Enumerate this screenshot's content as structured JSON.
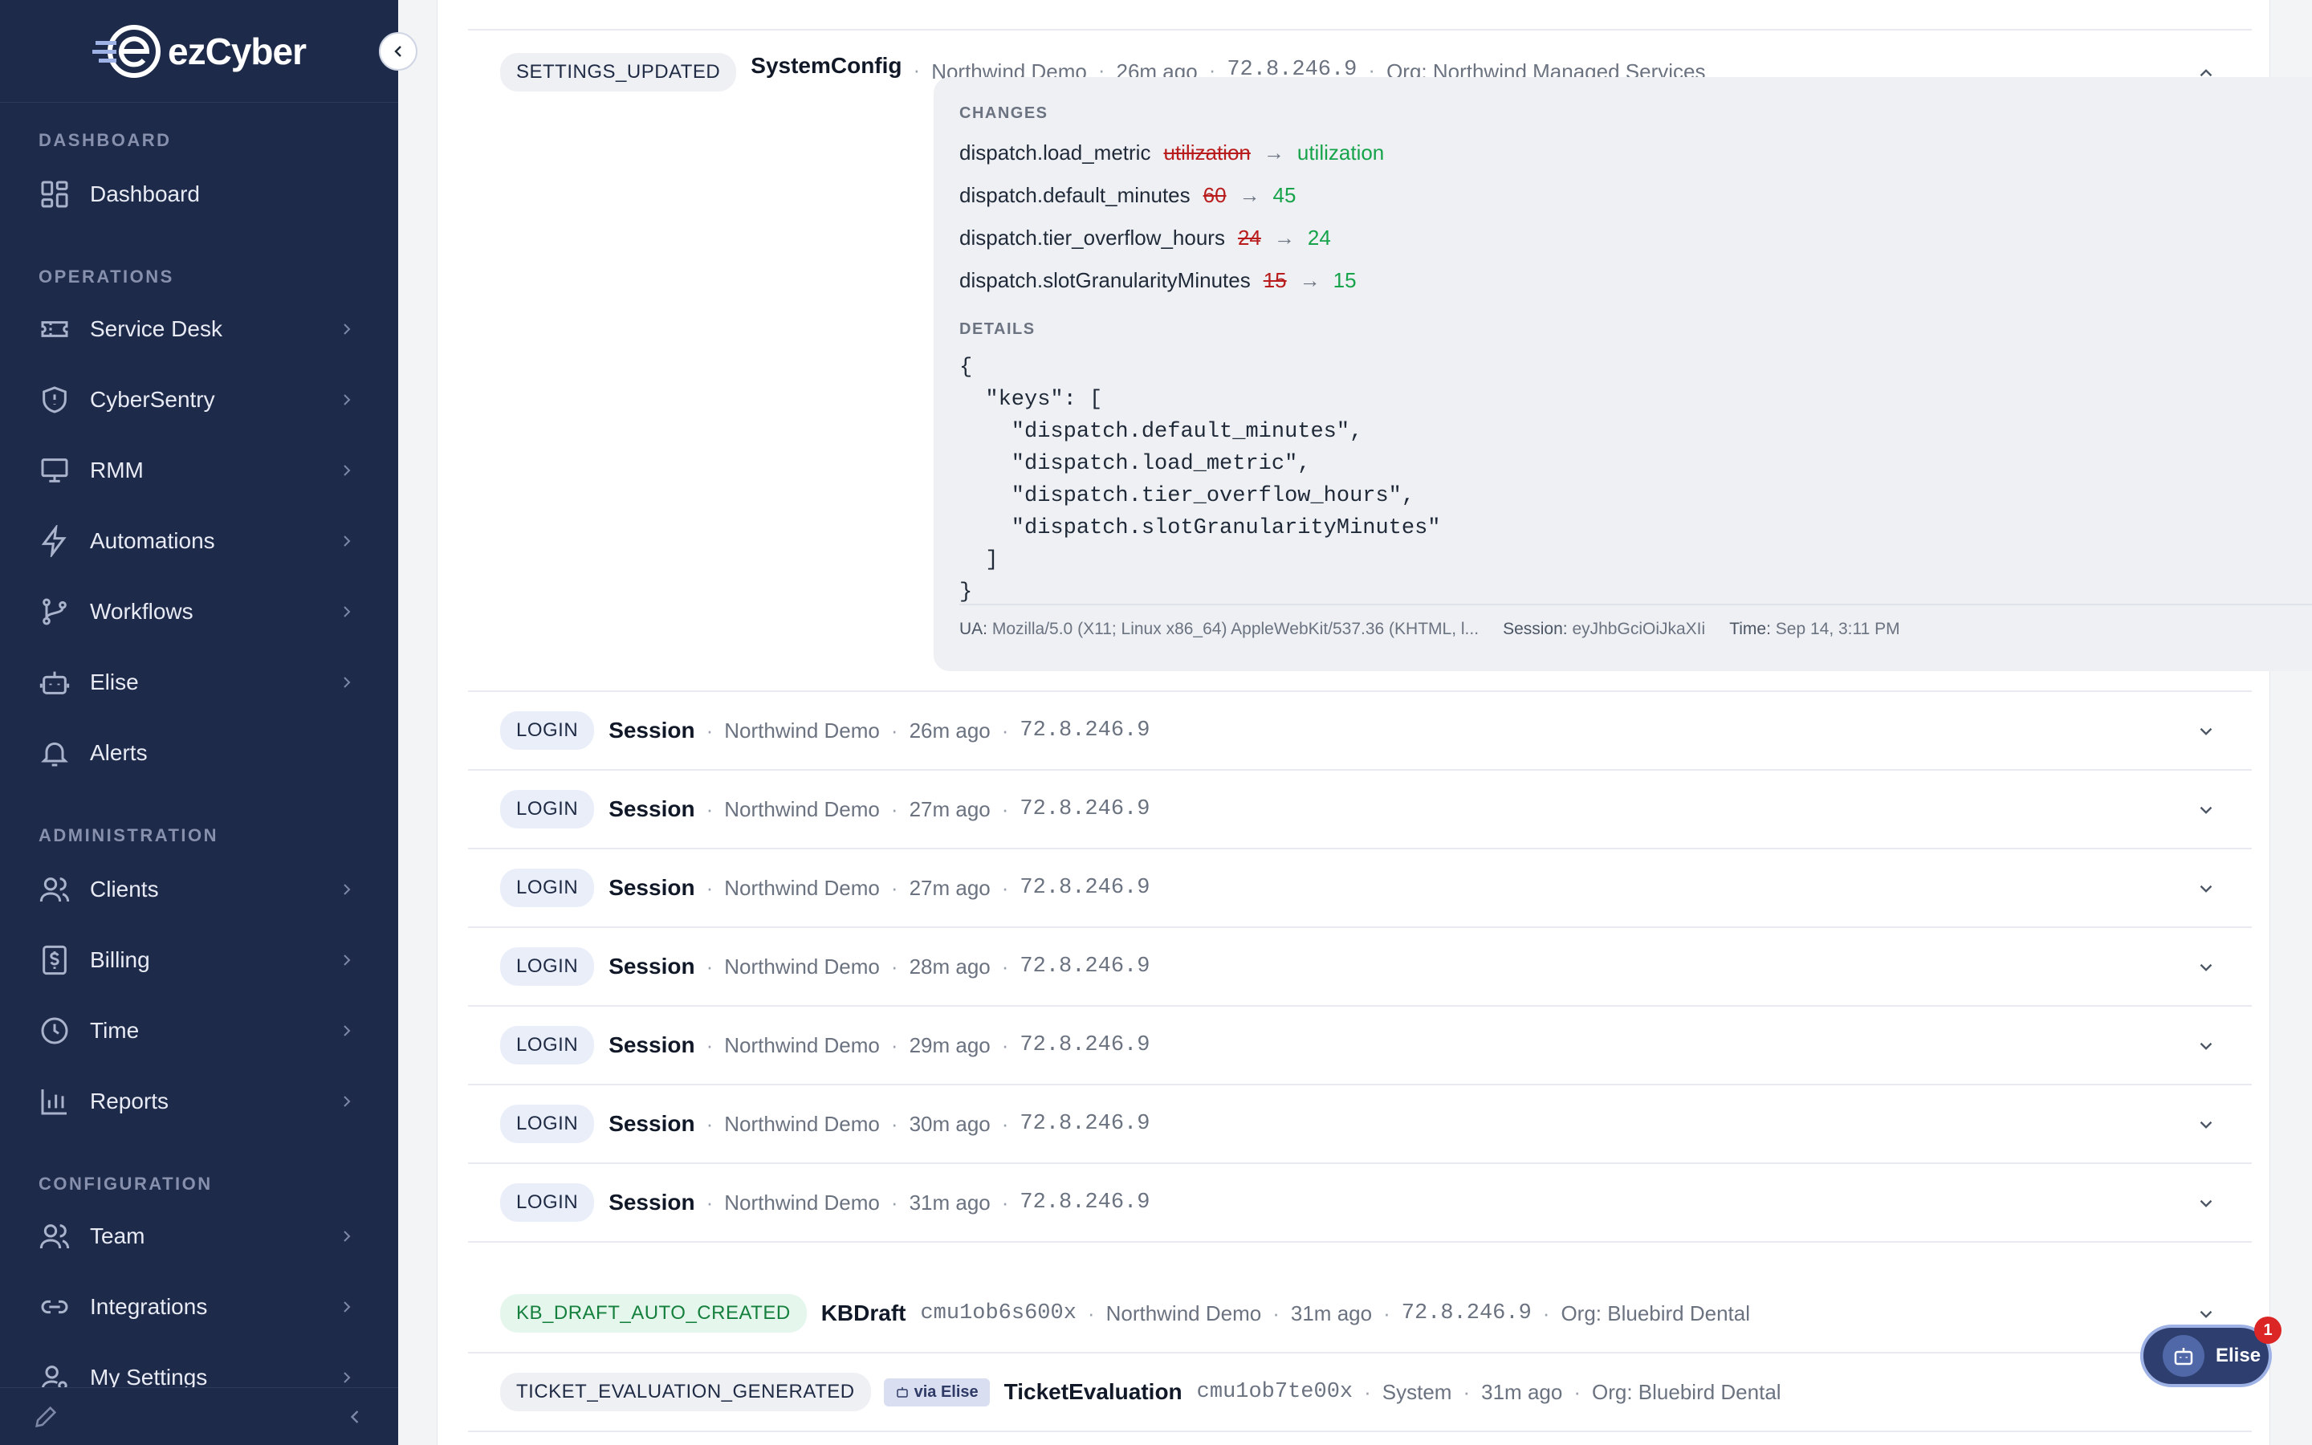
{
  "app": {
    "brand_prefix": "ez",
    "brand_suffix": "Cyber"
  },
  "sidebar": {
    "sections": {
      "dashboard": "DASHBOARD",
      "operations": "OPERATIONS",
      "administration": "ADMINISTRATION",
      "configuration": "CONFIGURATION"
    },
    "items": [
      {
        "label": "Dashboard",
        "icon": "grid-icon"
      },
      {
        "label": "Service Desk",
        "icon": "ticket-icon"
      },
      {
        "label": "CyberSentry",
        "icon": "shield-icon"
      },
      {
        "label": "RMM",
        "icon": "monitor-icon"
      },
      {
        "label": "Automations",
        "icon": "lightning-icon"
      },
      {
        "label": "Workflows",
        "icon": "branch-icon"
      },
      {
        "label": "Elise",
        "icon": "robot-icon"
      },
      {
        "label": "Alerts",
        "icon": "bell-icon"
      },
      {
        "label": "Clients",
        "icon": "users-icon"
      },
      {
        "label": "Billing",
        "icon": "dollar-icon"
      },
      {
        "label": "Time",
        "icon": "clock-icon"
      },
      {
        "label": "Reports",
        "icon": "bar-chart-icon"
      },
      {
        "label": "Team",
        "icon": "team-icon"
      },
      {
        "label": "Integrations",
        "icon": "link-icon"
      },
      {
        "label": "My Settings",
        "icon": "user-settings-icon"
      }
    ]
  },
  "expanded": {
    "badge": "SETTINGS_UPDATED",
    "entity": "SystemConfig",
    "org_name": "Northwind Demo",
    "time": "26m ago",
    "ip": "72.8.246.9",
    "org": "Org: Northwind Managed Services",
    "changes_label": "CHANGES",
    "changes": [
      {
        "key": "dispatch.load_metric",
        "old": "utilization",
        "new": "utilization"
      },
      {
        "key": "dispatch.default_minutes",
        "old": "60",
        "new": "45"
      },
      {
        "key": "dispatch.tier_overflow_hours",
        "old": "24",
        "new": "24"
      },
      {
        "key": "dispatch.slotGranularityMinutes",
        "old": "15",
        "new": "15"
      }
    ],
    "details_label": "DETAILS",
    "details_json": "{\n  \"keys\": [\n    \"dispatch.default_minutes\",\n    \"dispatch.load_metric\",\n    \"dispatch.tier_overflow_hours\",\n    \"dispatch.slotGranularityMinutes\"\n  ]\n}",
    "ua_label": "UA:",
    "ua": "Mozilla/5.0 (X11; Linux x86_64) AppleWebKit/537.36 (KHTML, l...",
    "session_label": "Session:",
    "session": "eyJhbGciOiJkaXIi",
    "time_label": "Time:",
    "timestamp": "Sep 14, 3:11 PM"
  },
  "logins": [
    {
      "badge": "LOGIN",
      "entity": "Session",
      "org": "Northwind Demo",
      "time": "26m ago",
      "ip": "72.8.246.9"
    },
    {
      "badge": "LOGIN",
      "entity": "Session",
      "org": "Northwind Demo",
      "time": "27m ago",
      "ip": "72.8.246.9"
    },
    {
      "badge": "LOGIN",
      "entity": "Session",
      "org": "Northwind Demo",
      "time": "27m ago",
      "ip": "72.8.246.9"
    },
    {
      "badge": "LOGIN",
      "entity": "Session",
      "org": "Northwind Demo",
      "time": "28m ago",
      "ip": "72.8.246.9"
    },
    {
      "badge": "LOGIN",
      "entity": "Session",
      "org": "Northwind Demo",
      "time": "29m ago",
      "ip": "72.8.246.9"
    },
    {
      "badge": "LOGIN",
      "entity": "Session",
      "org": "Northwind Demo",
      "time": "30m ago",
      "ip": "72.8.246.9"
    },
    {
      "badge": "LOGIN",
      "entity": "Session",
      "org": "Northwind Demo",
      "time": "31m ago",
      "ip": "72.8.246.9"
    }
  ],
  "kb_row": {
    "badge": "KB_DRAFT_AUTO_CREATED",
    "entity": "KBDraft",
    "id": "cmu1ob6s600x",
    "org_name": "Northwind Demo",
    "time": "31m ago",
    "ip": "72.8.246.9",
    "org": "Org: Bluebird Dental"
  },
  "ticket_row": {
    "badge": "TICKET_EVALUATION_GENERATED",
    "via": "via Elise",
    "entity": "TicketEvaluation",
    "id": "cmu1ob7te00x",
    "actor": "System",
    "time": "31m ago",
    "org": "Org: Bluebird Dental"
  },
  "elise_fab": {
    "label": "Elise",
    "count": "1"
  },
  "colors": {
    "sidebar": "#1e2a4a",
    "removed": "#b91c1c",
    "added": "#16a34a",
    "accent": "#2e3e6e"
  }
}
